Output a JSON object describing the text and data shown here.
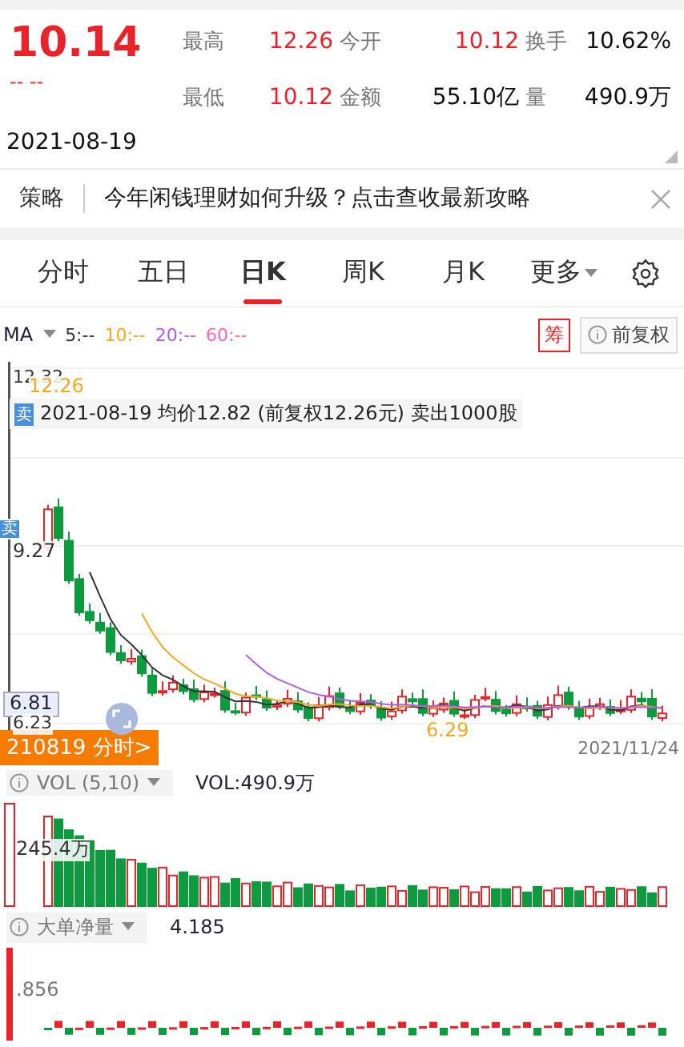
{
  "quote": {
    "price": "10.14",
    "change": "-- --",
    "stats": [
      {
        "label": "最高",
        "value": "12.26",
        "color": "#e8232a"
      },
      {
        "label": "今开",
        "value": "10.12",
        "color": "#e8232a"
      },
      {
        "label": "换手",
        "value": "10.62%",
        "color": "#111111"
      },
      {
        "label": "最低",
        "value": "10.12",
        "color": "#e8232a"
      },
      {
        "label": "金额",
        "value": "55.10亿",
        "color": "#111111"
      },
      {
        "label": "量",
        "value": "490.9万",
        "color": "#111111"
      }
    ],
    "date": "2021-08-19"
  },
  "banner": {
    "tag": "策略",
    "text": "今年闲钱理财如何升级？点击查收最新攻略"
  },
  "tabs": [
    {
      "label": "分时",
      "selected": false,
      "kind": "plain"
    },
    {
      "label": "五日",
      "selected": false,
      "kind": "plain"
    },
    {
      "label": "日K",
      "selected": true,
      "kind": "plain"
    },
    {
      "label": "周K",
      "selected": false,
      "kind": "plain"
    },
    {
      "label": "月K",
      "selected": false,
      "kind": "plain"
    },
    {
      "label": "更多",
      "selected": false,
      "kind": "dropdown"
    }
  ],
  "indicators": {
    "name": "MA",
    "lines": [
      {
        "label": "5:--",
        "color": "#333333"
      },
      {
        "label": "10:--",
        "color": "#f5a623"
      },
      {
        "label": "20:--",
        "color": "#b05ce8"
      },
      {
        "label": "60:--",
        "color": "#ff66b3"
      }
    ],
    "chip_button": "筹",
    "adjust_button": "前复权"
  },
  "kline": {
    "high_label": "12.32",
    "marker_label": "12.26",
    "note_badge": "卖",
    "note": "2021-08-19 均价12.82 (前复权12.26元) 卖出1000股",
    "side_badge": "卖",
    "mid_label": "9.27",
    "crosshair_label": "6.81",
    "low_label": "6.23",
    "min_label": "6.29",
    "period_button": "210819 分时>",
    "end_date": "2021/11/24"
  },
  "volume": {
    "name": "VOL (5,10)",
    "reading": "VOL:490.9万",
    "axis_label": "245.4万"
  },
  "net": {
    "name": "大单净量",
    "reading": "4.185",
    "axis_label": ".856"
  }
}
